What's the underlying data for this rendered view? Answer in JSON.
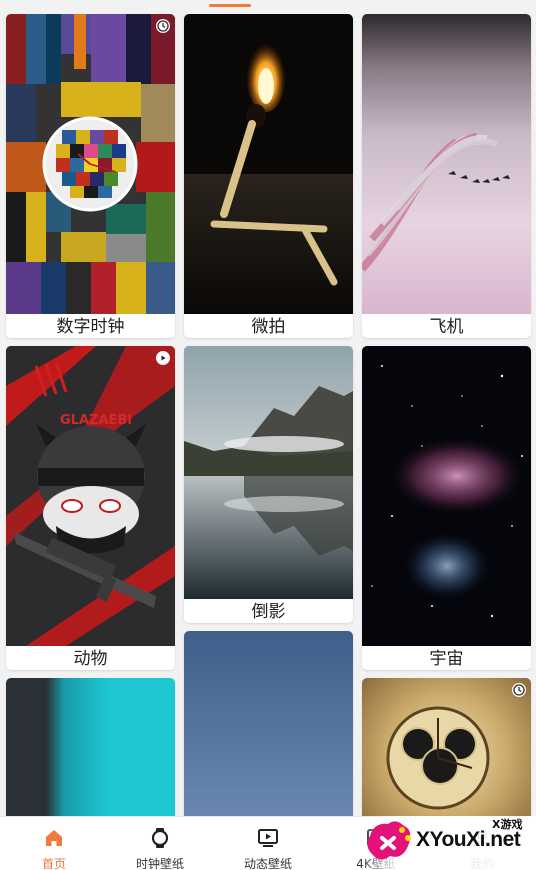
{
  "wallpapers": [
    {
      "caption": "数字时钟",
      "badge": "clock"
    },
    {
      "caption": "微拍"
    },
    {
      "caption": "飞机"
    },
    {
      "caption": "动物",
      "badge": "play"
    },
    {
      "caption": "倒影"
    },
    {
      "caption": "宇宙"
    },
    {
      "caption": ""
    },
    {
      "caption": ""
    },
    {
      "caption": "",
      "badge": "clock"
    }
  ],
  "poster_text": "GLAZAEBI",
  "nav": [
    {
      "label": "首页",
      "icon": "home-icon",
      "active": true
    },
    {
      "label": "时钟壁纸",
      "icon": "watch-icon"
    },
    {
      "label": "动态壁纸",
      "icon": "play-screen-icon"
    },
    {
      "label": "4K壁纸",
      "icon": "image-icon"
    },
    {
      "label": "我的",
      "icon": "user-icon"
    }
  ],
  "watermark": {
    "top": "X游戏",
    "main": "XYouXi.net"
  },
  "colors": {
    "accent": "#f07a3a"
  }
}
